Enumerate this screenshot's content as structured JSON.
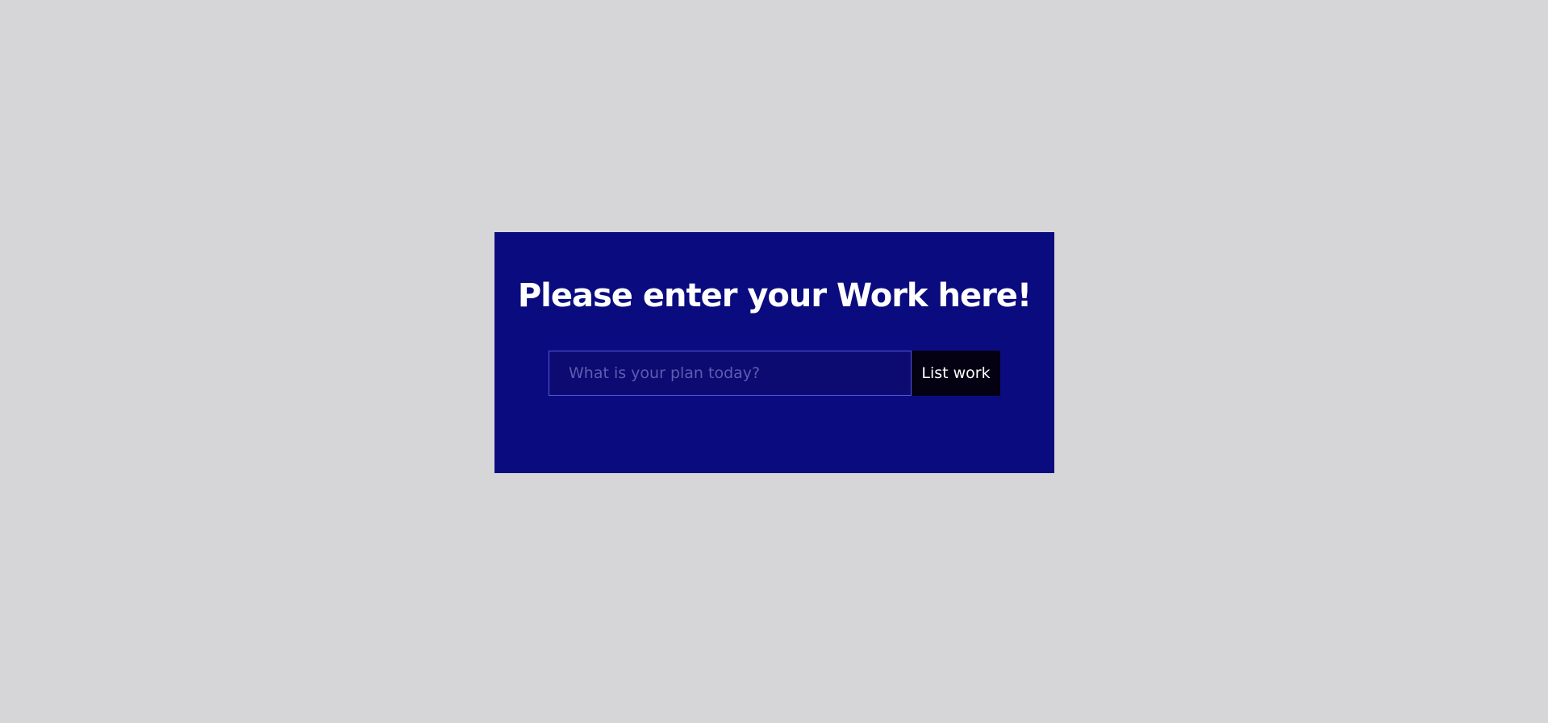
{
  "todo": {
    "title": "Please enter your Work here!",
    "input_placeholder": "What is your plan today?",
    "input_value": "",
    "submit_label": "List work"
  },
  "colors": {
    "page_background": "#d6d6d8",
    "card_background": "#0b0b80",
    "input_background": "#0b0b72",
    "input_border": "#5d54e0",
    "button_background": "#040112",
    "text": "#ffffff"
  }
}
